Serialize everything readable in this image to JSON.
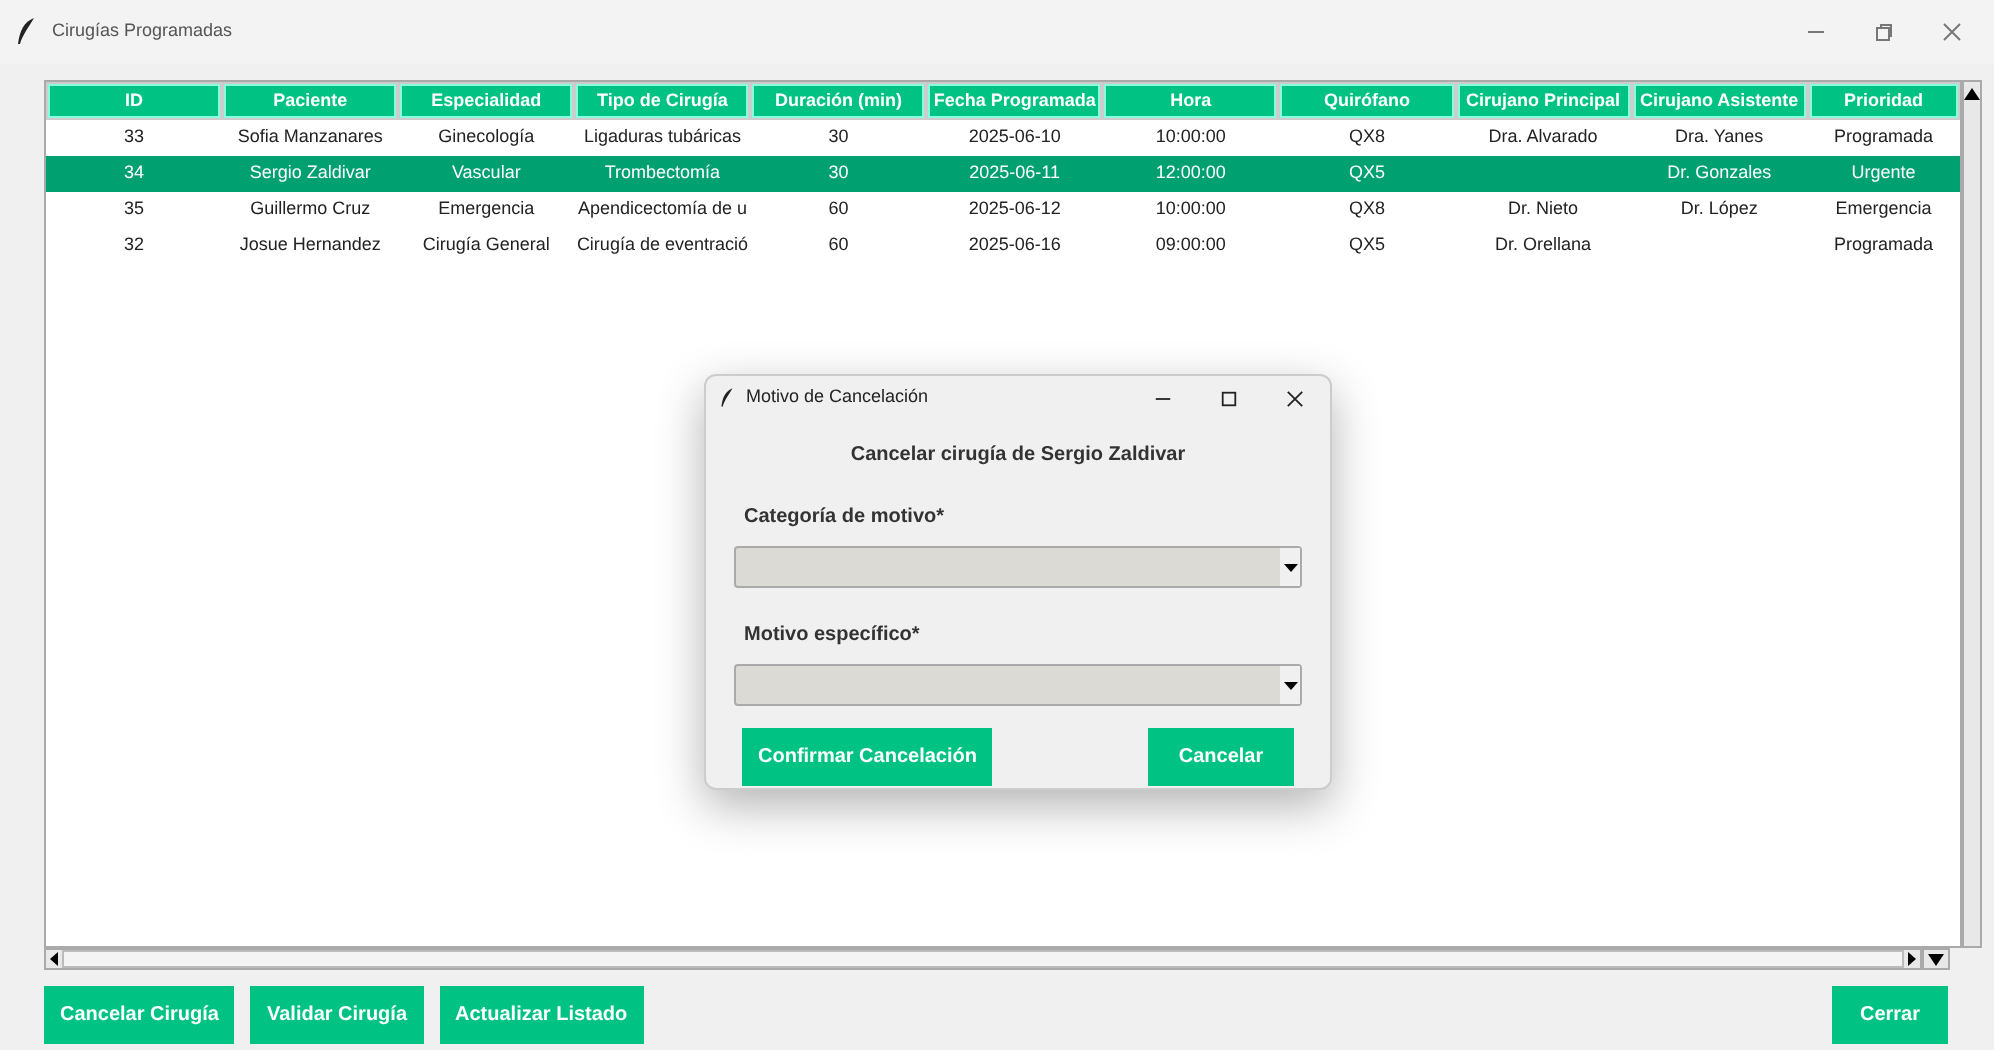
{
  "window": {
    "title": "Cirugías Programadas"
  },
  "table": {
    "columns": [
      "ID",
      "Paciente",
      "Especialidad",
      "Tipo de Cirugía",
      "Duración (min)",
      "Fecha Programada",
      "Hora",
      "Quirófano",
      "Cirujano Principal",
      "Cirujano Asistente",
      "Prioridad"
    ],
    "rows": [
      {
        "selected": false,
        "cells": [
          "33",
          "Sofia Manzanares",
          "Ginecología",
          "Ligaduras tubáricas",
          "30",
          "2025-06-10",
          "10:00:00",
          "QX8",
          "Dra. Alvarado",
          "Dra. Yanes",
          "Programada"
        ]
      },
      {
        "selected": true,
        "cells": [
          "34",
          "Sergio Zaldivar",
          "Vascular",
          "Trombectomía",
          "30",
          "2025-06-11",
          "12:00:00",
          "QX5",
          "",
          "Dr. Gonzales",
          "Urgente"
        ]
      },
      {
        "selected": false,
        "cells": [
          "35",
          "Guillermo Cruz",
          "Emergencia",
          "Apendicectomía de u",
          "60",
          "2025-06-12",
          "10:00:00",
          "QX8",
          "Dr. Nieto",
          "Dr. López",
          "Emergencia"
        ]
      },
      {
        "selected": false,
        "cells": [
          "32",
          "Josue Hernandez",
          "Cirugía General",
          "Cirugía de eventració",
          "60",
          "2025-06-16",
          "09:00:00",
          "QX5",
          "Dr. Orellana",
          "",
          "Programada"
        ]
      }
    ]
  },
  "buttons": [
    "Cancelar Cirugía",
    "Validar Cirugía",
    "Actualizar Listado"
  ],
  "close_button": "Cerrar",
  "dialog": {
    "title": "Motivo de Cancelación",
    "heading": "Cancelar cirugía de Sergio Zaldivar",
    "fields": [
      {
        "label": "Categoría de motivo*"
      },
      {
        "label": "Motivo específico*"
      }
    ],
    "confirm_button": "Confirmar Cancelación",
    "cancel_button": "Cancelar"
  }
}
